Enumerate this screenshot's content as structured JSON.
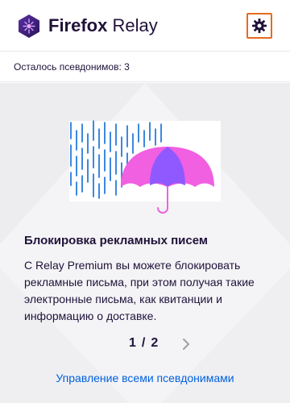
{
  "header": {
    "brand": "Firefox",
    "product": "Relay",
    "settings_icon": "gear-icon"
  },
  "status": {
    "text": "Осталось псевдонимов: 3"
  },
  "tip": {
    "illustration_icon": "umbrella-rain-illustration",
    "title": "Блокировка рекламных писем",
    "body": "С Relay Premium вы можете блокировать рекламные письма, при этом получая такие электронные письма, как квитанции и информацию о доставке."
  },
  "pagination": {
    "current": "1",
    "separator": "/",
    "total": "2",
    "next_icon": "chevron-right-icon"
  },
  "footer": {
    "manage_link": "Управление всеми псевдонимами"
  },
  "colors": {
    "accent_orange": "#e66a1f",
    "link_blue": "#0060df",
    "rain_blue": "#0c6bd8",
    "umbrella_pink": "#f060e0",
    "umbrella_purple": "#9059ff",
    "logo_purple": "#3d1f6b"
  }
}
